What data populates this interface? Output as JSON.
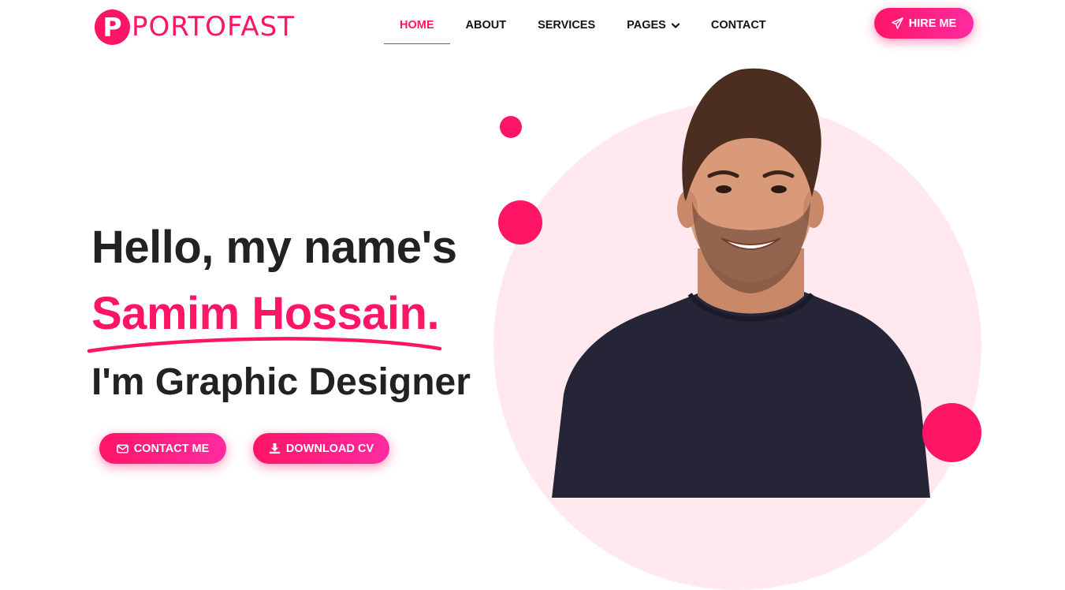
{
  "header": {
    "logo_mark": "P",
    "logo_text": "PORTOFAST",
    "nav": [
      {
        "label": "HOME",
        "active": true
      },
      {
        "label": "ABOUT",
        "active": false
      },
      {
        "label": "SERVICES",
        "active": false
      },
      {
        "label": "PAGES",
        "active": false,
        "dropdown": true
      },
      {
        "label": "CONTACT",
        "active": false
      }
    ],
    "hire_label": "HIRE ME",
    "hire_icon": "paper-plane-icon"
  },
  "hero": {
    "greeting": "Hello, my name's",
    "name": "Samim Hossain.",
    "role": "I'm Graphic Designer",
    "contact_label": "CONTACT ME",
    "contact_icon": "envelope-icon",
    "download_label": "DOWNLOAD CV",
    "download_icon": "download-icon"
  },
  "colors": {
    "accent": "#ff1566",
    "accent_alt": "#ff2ba0",
    "text_dark": "#222222",
    "circle_bg": "#ffe9ee"
  }
}
